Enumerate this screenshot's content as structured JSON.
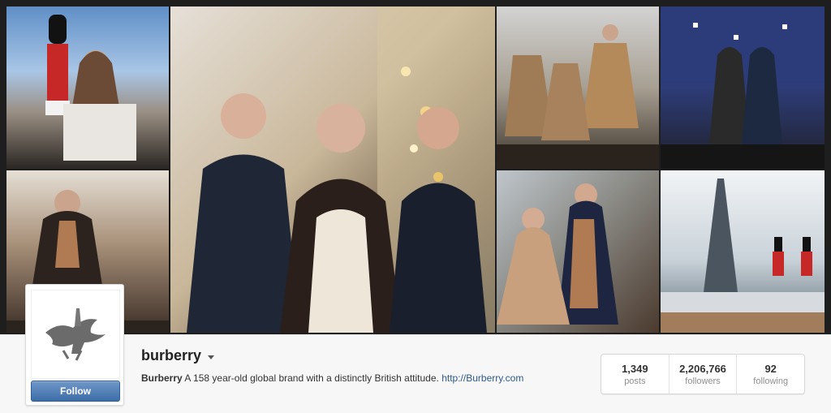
{
  "profile": {
    "username": "burberry",
    "bio_name": "Burberry",
    "bio_text": " A 158 year-old global brand with a distinctly British attitude. ",
    "bio_link": "http://Burberry.com",
    "follow_label": "Follow"
  },
  "stats": [
    {
      "value": "1,349",
      "label": "posts"
    },
    {
      "value": "2,206,766",
      "label": "followers"
    },
    {
      "value": "92",
      "label": "following"
    }
  ],
  "colors": {
    "follow_button": "#3d6ea8",
    "link": "#2d5b8b",
    "mosaic_bg": "#1e1e1e"
  },
  "icons": {
    "avatar": "burberry-knight-logo",
    "dropdown": "caret-down-icon"
  }
}
